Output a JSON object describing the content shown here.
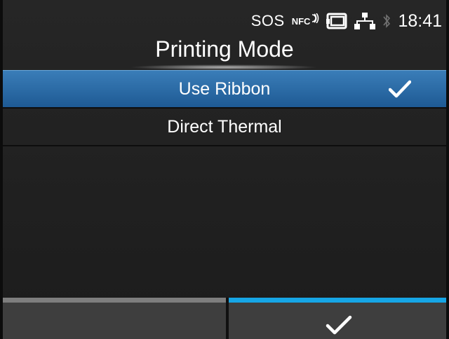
{
  "status_bar": {
    "sos_label": "SOS",
    "nfc_label": "NFC",
    "time": "18:41",
    "icons": [
      "nfc-icon",
      "sd-card-icon",
      "network-icon",
      "bluetooth-icon"
    ]
  },
  "screen": {
    "title": "Printing Mode"
  },
  "options": [
    {
      "label": "Use Ribbon",
      "selected": true
    },
    {
      "label": "Direct Thermal",
      "selected": false
    }
  ],
  "softkeys": {
    "left_icon": "",
    "right_icon": "checkmark-icon"
  },
  "colors": {
    "selection": "#2a6aa6",
    "accent": "#16a6e6",
    "background": "#1f1f1f"
  }
}
